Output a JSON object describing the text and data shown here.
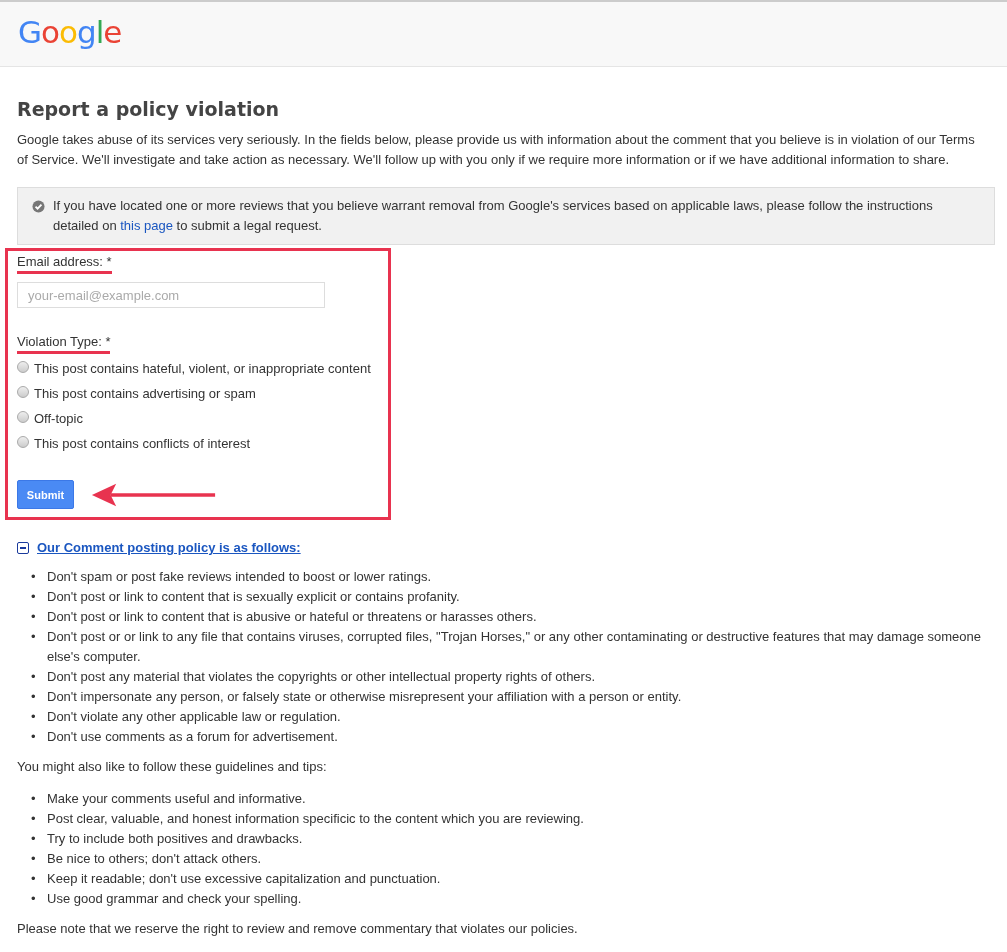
{
  "header": {
    "logo": "Google"
  },
  "title": "Report a policy violation",
  "intro": "Google takes abuse of its services very seriously. In the fields below, please provide us with information about the comment that you believe is in violation of our Terms of Service. We'll investigate and take action as necessary. We'll follow up with you only if we require more information or if we have additional information to share.",
  "notice": {
    "before": "If you have located one or more reviews that you believe warrant removal from Google's services based on applicable laws, please follow the instructions detailed on",
    "link": "this page",
    "after": "to submit a legal request."
  },
  "form": {
    "email_label": "Email address: *",
    "email_placeholder": "your-email@example.com",
    "type_label": "Violation Type: *",
    "options": [
      {
        "label": "This post contains hateful, violent, or inappropriate content",
        "selected": false
      },
      {
        "label": "This post contains advertising or spam",
        "selected": false
      },
      {
        "label": "Off-topic",
        "selected": false
      },
      {
        "label": "This post contains conflicts of interest",
        "selected": false
      }
    ],
    "submit": "Submit"
  },
  "policy": {
    "heading": "Our Comment posting policy is as follows:",
    "expanded": true,
    "rules": [
      {
        "bullet": "•",
        "text": "Don't spam or post fake reviews intended to boost or lower ratings."
      },
      {
        "bullet": "•",
        "text": "Don't post or link to content that is sexually explicit or contains profanity."
      },
      {
        "bullet": "•",
        "text": "Don't post or link to content that is abusive or hateful or threatens or harasses others."
      },
      {
        "bullet": "•",
        "text": "Don't post or or link to any file that contains viruses, corrupted files, \"Trojan Horses,\" or any other contaminating or destructive features that may damage someone else's computer."
      },
      {
        "bullet": "•",
        "text": "Don't post any material that violates the copyrights or other intellectual property rights of others."
      },
      {
        "bullet": "•",
        "text": "Don't impersonate any person, or falsely state or otherwise misrepresent your affiliation with a person or entity."
      },
      {
        "bullet": "•",
        "text": "Don't violate any other applicable law or regulation."
      },
      {
        "bullet": "•",
        "text": "Don't use comments as a forum for advertisement."
      }
    ],
    "tips_intro": "You might also like to follow these guidelines and tips:",
    "tips": [
      {
        "bullet": "•",
        "text": "Make your comments useful and informative."
      },
      {
        "bullet": "•",
        "text": "Post clear, valuable, and honest information specificic to the content which you are reviewing."
      },
      {
        "bullet": "•",
        "text": "Try to include both positives and drawbacks."
      },
      {
        "bullet": "•",
        "text": "Be nice to others; don't attack others."
      },
      {
        "bullet": "•",
        "text": "Keep it readable; don't use excessive capitalization and punctuation."
      },
      {
        "bullet": "•",
        "text": "Use good grammar and check your spelling."
      }
    ],
    "footer": "Please note that we reserve the right to review and remove commentary that violates our policies."
  }
}
